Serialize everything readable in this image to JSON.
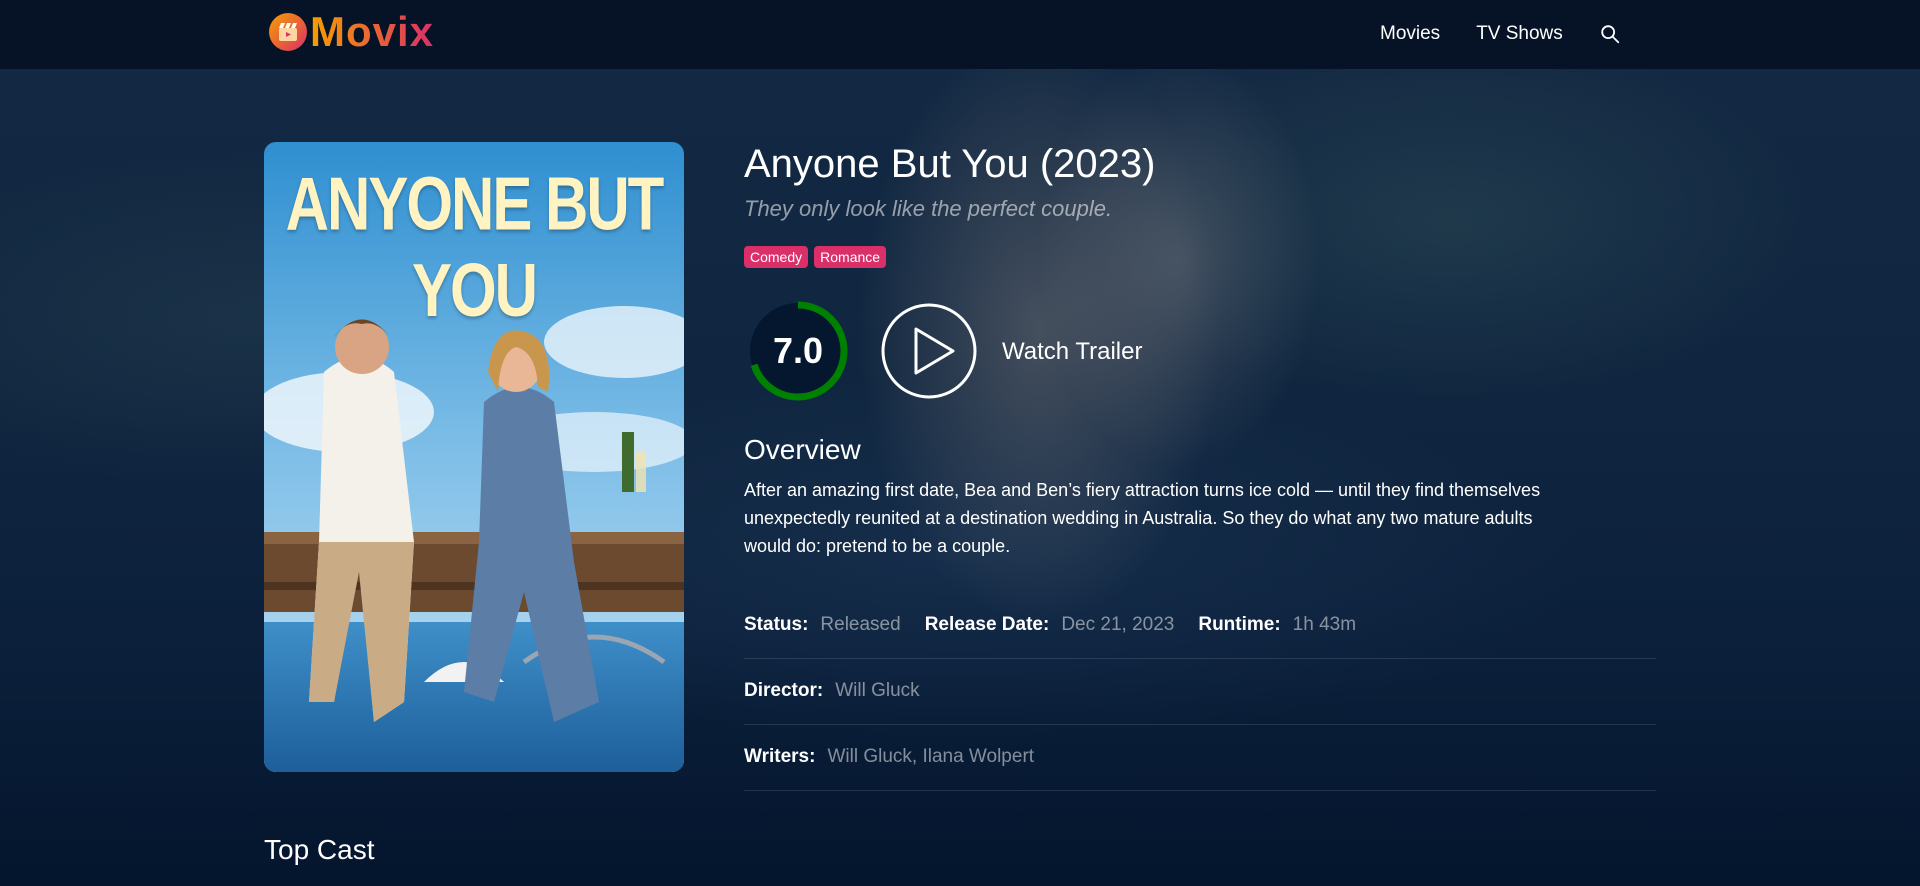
{
  "app": {
    "logo_text": "Movix",
    "brand_gradient": [
      "#f89e00",
      "#da2f68"
    ]
  },
  "nav": {
    "items": [
      {
        "label": "Movies"
      },
      {
        "label": "TV Shows"
      }
    ],
    "search_icon": "search-icon"
  },
  "movie": {
    "poster_text": "ANYONE BUT YOU",
    "title": "Anyone But You (2023)",
    "tagline": "They only look like the perfect couple.",
    "genres": [
      "Comedy",
      "Romance"
    ],
    "genre_color": "#da2f68",
    "rating": "7.0",
    "rating_fraction": 0.7,
    "rating_color": "#008000",
    "trailer_label": "Watch Trailer",
    "overview_heading": "Overview",
    "overview": "After an amazing first date, Bea and Ben’s fiery attraction turns ice cold — until they find themselves unexpectedly reunited at a destination wedding in Australia. So they do what any two mature adults would do: pretend to be a couple.",
    "info": {
      "status_label": "Status:",
      "status": "Released",
      "release_label": "Release Date:",
      "release_date": "Dec 21, 2023",
      "runtime_label": "Runtime:",
      "runtime": "1h 43m",
      "director_label": "Director:",
      "director": "Will Gluck",
      "writers_label": "Writers:",
      "writers": "Will Gluck, Ilana Wolpert"
    }
  },
  "sections": {
    "top_cast": "Top Cast"
  }
}
